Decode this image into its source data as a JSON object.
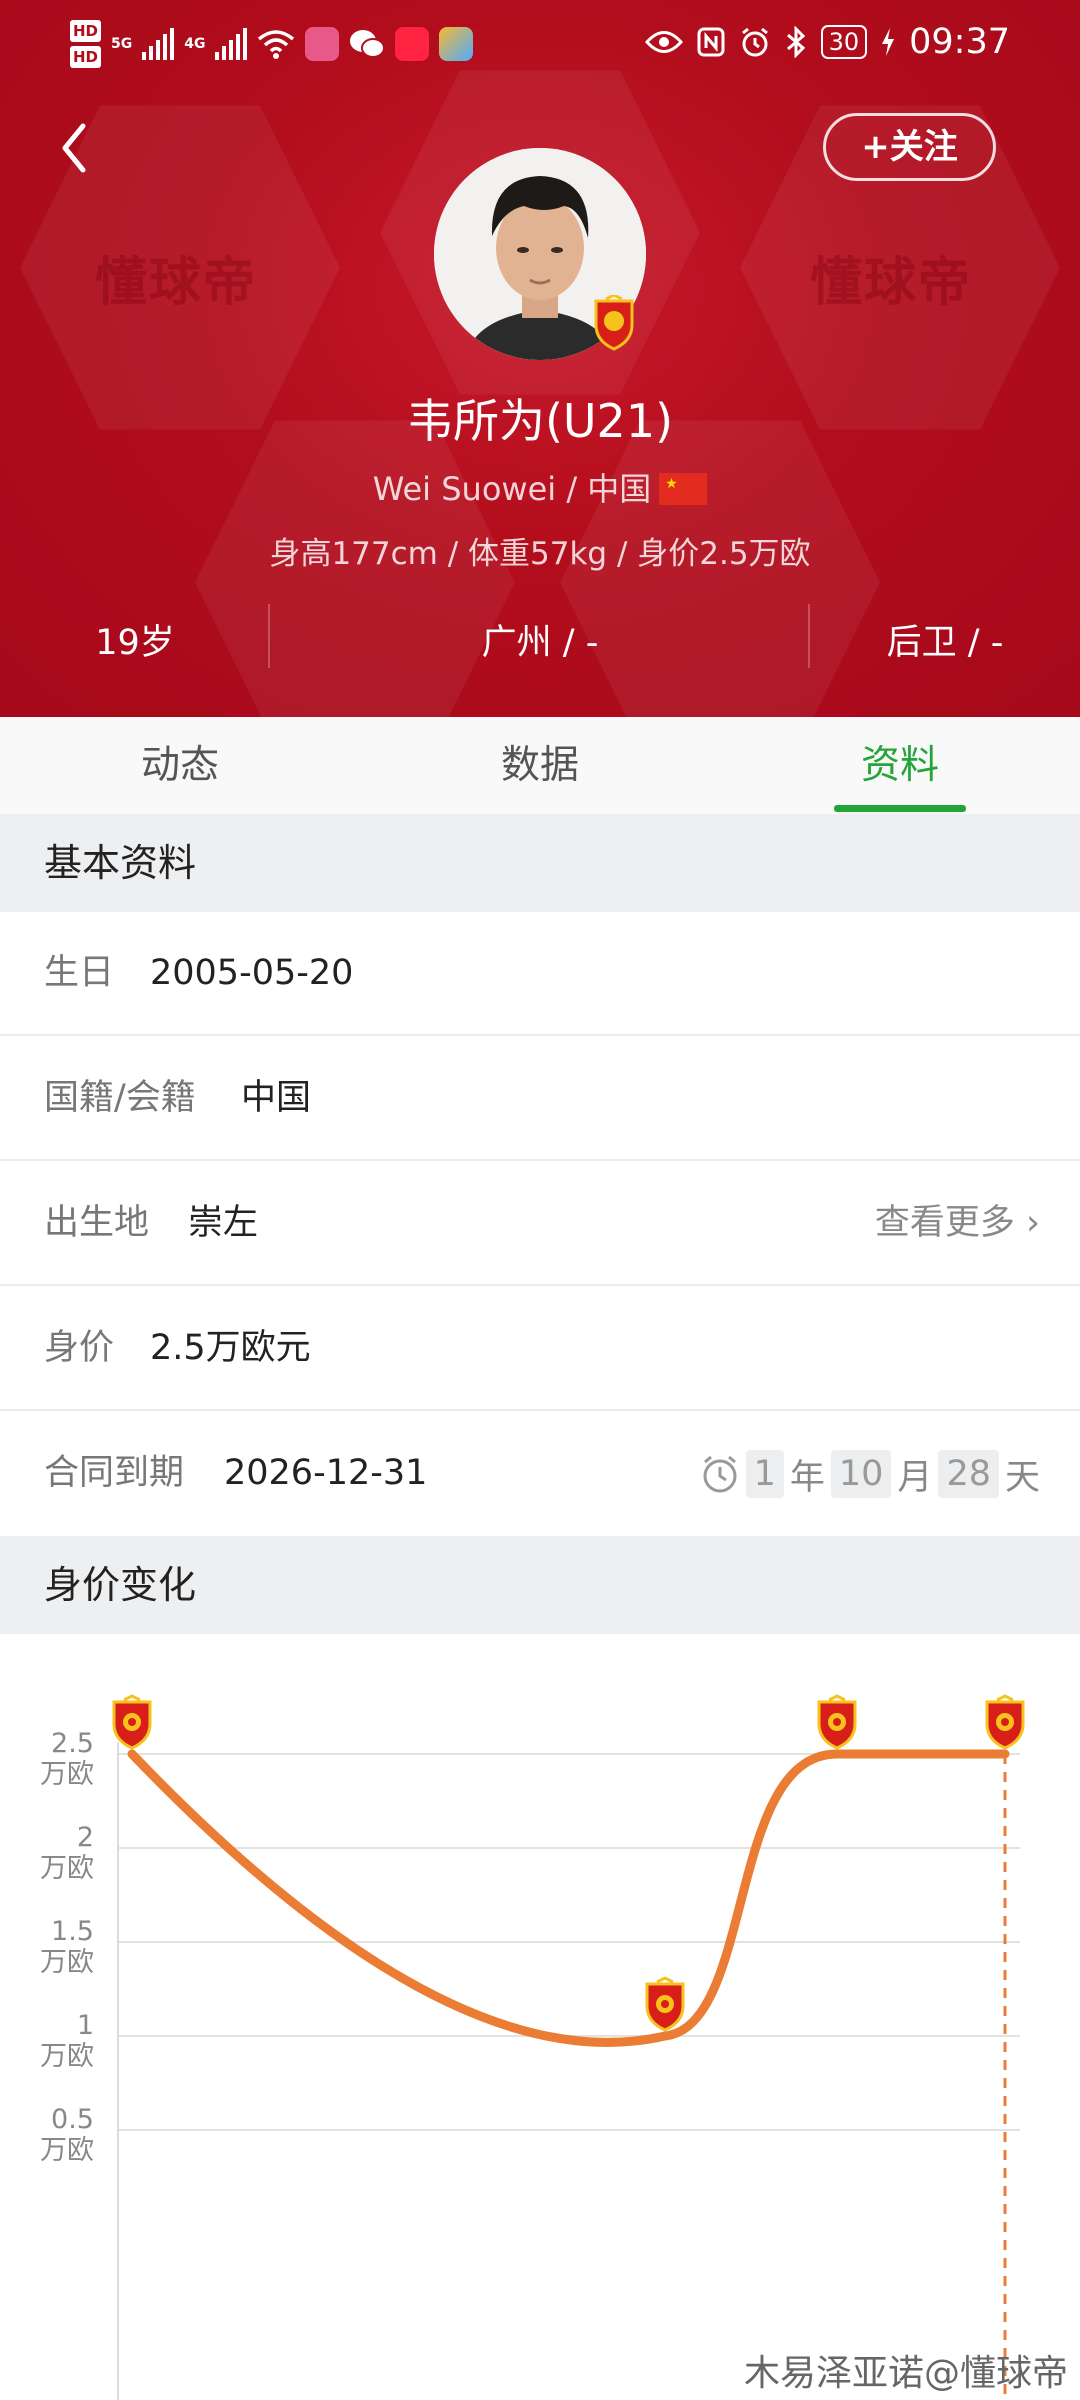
{
  "status_bar": {
    "time": "09:37",
    "battery": "30",
    "net_5g": "5G",
    "net_4g": "4G",
    "hd1": "HD",
    "hd2": "HD"
  },
  "header": {
    "follow_label": "+关注",
    "name": "韦所为(U21)",
    "name_en": "Wei Suowei / 中国",
    "stats": "身高177cm / 体重57kg / 身价2.5万欧",
    "age": "19岁",
    "city": "广州 / -",
    "position": "后卫 / -",
    "watermark": "懂球帝"
  },
  "tabs": [
    {
      "label": "动态",
      "active": false
    },
    {
      "label": "数据",
      "active": false
    },
    {
      "label": "资料",
      "active": true
    }
  ],
  "basic_info": {
    "section_title": "基本资料",
    "birthday_label": "生日",
    "birthday": "2005-05-20",
    "nationality_label": "国籍/会籍",
    "nationality": "中国",
    "birthplace_label": "出生地",
    "birthplace": "崇左",
    "see_more": "查看更多",
    "value_label": "身价",
    "value": "2.5万欧元",
    "contract_label": "合同到期",
    "contract": "2026-12-31",
    "countdown": {
      "years": "1",
      "year_unit": "年",
      "months": "10",
      "month_unit": "月",
      "days": "28",
      "day_unit": "天"
    }
  },
  "value_section": {
    "title": "身价变化"
  },
  "chart_data": {
    "type": "line",
    "y_ticks": [
      {
        "value": 2.5,
        "label": "2.5",
        "unit": "万欧"
      },
      {
        "value": 2,
        "label": "2",
        "unit": "万欧"
      },
      {
        "value": 1.5,
        "label": "1.5",
        "unit": "万欧"
      },
      {
        "value": 1,
        "label": "1",
        "unit": "万欧"
      },
      {
        "value": 0.5,
        "label": "0.5",
        "unit": "万欧"
      }
    ],
    "points": [
      {
        "value": 2.5,
        "club_badge": "guangzhou-crest"
      },
      {
        "value": 1.0,
        "club_badge": "guangzhou-instar-crest"
      },
      {
        "value": 2.5,
        "club_badge": "guangzhou-instar-crest"
      },
      {
        "value": 2.5,
        "club_badge": "guangzhou-crest"
      }
    ],
    "line_color": "#ea7d33",
    "grid": true
  },
  "footer": {
    "credit": "木易泽亚诺@懂球帝"
  },
  "colors": {
    "hero_bg": "#b20d1c",
    "accent_green": "#24a53a",
    "line_orange": "#ea7d33"
  }
}
